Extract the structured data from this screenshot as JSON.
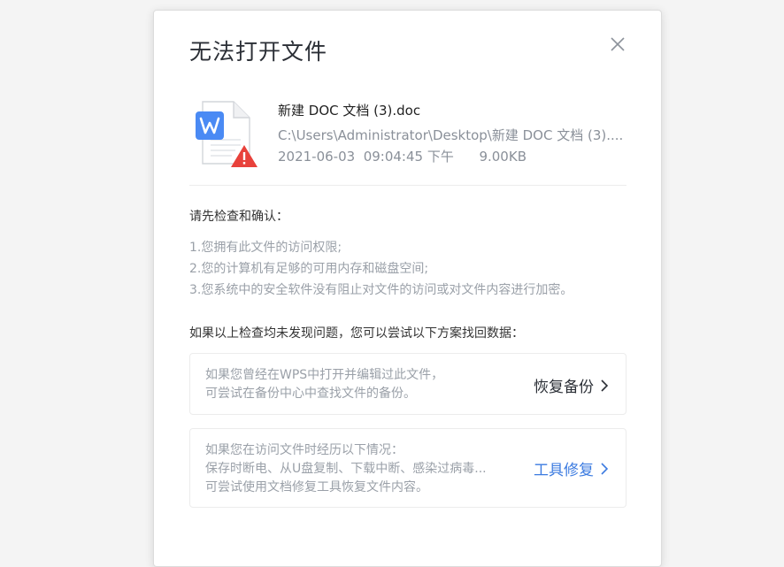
{
  "dialog": {
    "title": "无法打开文件"
  },
  "file": {
    "name": "新建 DOC 文档 (3).doc",
    "path": "C:\\Users\\Administrator\\Desktop\\新建 DOC 文档 (3)....",
    "meta": "2021-06-03  09:04:45 下午      9.00KB",
    "icon": "wps-writer-file-icon",
    "warning_color": "#e8413b",
    "brand_color": "#4a8af4"
  },
  "check": {
    "title": "请先检查和确认：",
    "items": [
      "1.您拥有此文件的访问权限;",
      "2.您的计算机有足够的可用内存和磁盘空间;",
      "3.您系统中的安全软件没有阻止对文件的访问或对文件内容进行加密。"
    ]
  },
  "solutions": {
    "title": "如果以上检查均未发现问题，您可以尝试以下方案找回数据：",
    "backup": {
      "lines": [
        "如果您曾经在WPS中打开并编辑过此文件，",
        "可尝试在备份中心中查找文件的备份。"
      ],
      "action": "恢复备份"
    },
    "repair": {
      "lines": [
        "如果您在访问文件时经历以下情况：",
        "保存时断电、从U盘复制、下载中断、感染过病毒...",
        "可尝试使用文档修复工具恢复文件内容。"
      ],
      "action": "工具修复",
      "action_color": "#3c7be0"
    }
  }
}
